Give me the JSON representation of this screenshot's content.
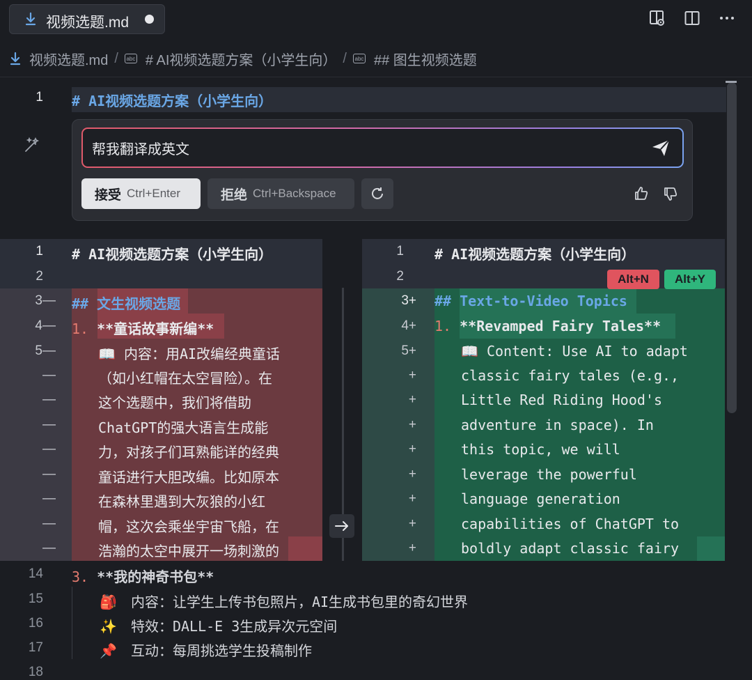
{
  "tab": {
    "filename": "视频选题.md"
  },
  "breadcrumb": {
    "file": "视频选题.md",
    "section1": "# AI视频选题方案（小学生向）",
    "section2": "## 图生视频选题"
  },
  "editor": {
    "line1": {
      "no": "1",
      "hash": "#",
      "text": "AI视频选题方案（小学生向）"
    }
  },
  "chat": {
    "input_value": "帮我翻译成英文",
    "accept_label": "接受",
    "accept_shortcut": "Ctrl+Enter",
    "reject_label": "拒绝",
    "reject_shortcut": "Ctrl+Backspace"
  },
  "diff": {
    "badge_reject": "Alt+N",
    "badge_accept": "Alt+Y",
    "left": {
      "gutter": [
        "1",
        "2",
        "3—",
        "4—",
        "5—",
        "—",
        "—",
        "—",
        "—",
        "—",
        "—",
        "—",
        "—"
      ],
      "l1": "# AI视频选题方案（小学生向）",
      "l3_hash": "##",
      "l3_text": "文生视频选题",
      "l4_num": "1.",
      "l4_text": "**童话故事新编**",
      "l5": "📖 内容：用AI改编经典童话",
      "wrap": [
        "（如小红帽在太空冒险）。在",
        "这个选题中，我们将借助",
        "ChatGPT的强大语言生成能",
        "力，对孩子们耳熟能详的经典",
        "童话进行大胆改编。比如原本",
        "在森林里遇到大灰狼的小红",
        "帽，这次会乘坐宇宙飞船，在",
        "浩瀚的太空中展开一场刺激的"
      ]
    },
    "right": {
      "gutter": [
        "1",
        "2",
        "3+",
        "4+",
        "5+",
        "+",
        "+",
        "+",
        "+",
        "+",
        "+",
        "+",
        "+"
      ],
      "l1": "# AI视频选题方案（小学生向）",
      "l3_hash": "##",
      "l3_text": "Text-to-Video Topics",
      "l4_num": "1.",
      "l4_text": "**Revamped Fairy Tales**",
      "l5": "📖 Content: Use AI to adapt",
      "wrap": [
        "classic fairy tales (e.g.,",
        "Little Red Riding Hood's",
        "adventure in space). In",
        "this topic, we will",
        "leverage the powerful",
        "language generation",
        "capabilities of ChatGPT to",
        "boldly adapt classic fairy"
      ]
    }
  },
  "bottom": {
    "lines": [
      {
        "no": "14",
        "num": "3.",
        "text": "**我的神奇书包**"
      },
      {
        "no": "15",
        "emoji": "🎒",
        "text": "内容：让学生上传书包照片，AI生成书包里的奇幻世界"
      },
      {
        "no": "16",
        "emoji": "✨",
        "text": "特效：DALL-E 3生成异次元空间"
      },
      {
        "no": "17",
        "emoji": "📌",
        "text": "互动：每周挑选学生投稿制作"
      },
      {
        "no": "18"
      }
    ]
  }
}
